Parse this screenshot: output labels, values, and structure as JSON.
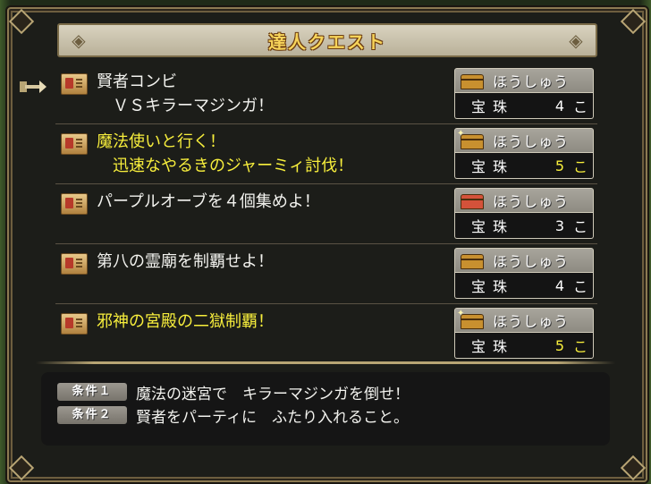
{
  "title": "達人クエスト",
  "quests": [
    {
      "title": "賢者コンビ\n　ＶＳキラーマジンガ！",
      "highlight": false,
      "chest": "gold",
      "reward_label": "ほうしゅう",
      "reward_name": "宝珠",
      "reward_count": "4",
      "reward_unit": "こ"
    },
    {
      "title": "魔法使いと行く！\n　迅速なやるきのジャーミィ討伐！",
      "highlight": true,
      "chest": "gold-sparkle",
      "reward_label": "ほうしゅう",
      "reward_name": "宝珠",
      "reward_count": "5",
      "reward_unit": "こ"
    },
    {
      "title": "パープルオーブを４個集めよ！",
      "highlight": false,
      "chest": "red",
      "reward_label": "ほうしゅう",
      "reward_name": "宝珠",
      "reward_count": "3",
      "reward_unit": "こ"
    },
    {
      "title": "第八の霊廟を制覇せよ！",
      "highlight": false,
      "chest": "gold",
      "reward_label": "ほうしゅう",
      "reward_name": "宝珠",
      "reward_count": "4",
      "reward_unit": "こ"
    },
    {
      "title": "邪神の宮殿の二獄制覇！",
      "highlight": true,
      "chest": "gold-sparkle",
      "reward_label": "ほうしゅう",
      "reward_name": "宝珠",
      "reward_count": "5",
      "reward_unit": "こ"
    }
  ],
  "conditions": [
    {
      "badge": "条件１",
      "text": "魔法の迷宮で　キラーマジンガを倒せ！"
    },
    {
      "badge": "条件２",
      "text": "賢者をパーティに　ふたり入れること。"
    }
  ],
  "colors": {
    "highlight": "#f7ee3c",
    "title": "#f7d45a",
    "normal_text": "#f2f2ee"
  },
  "selected_quest": 0
}
